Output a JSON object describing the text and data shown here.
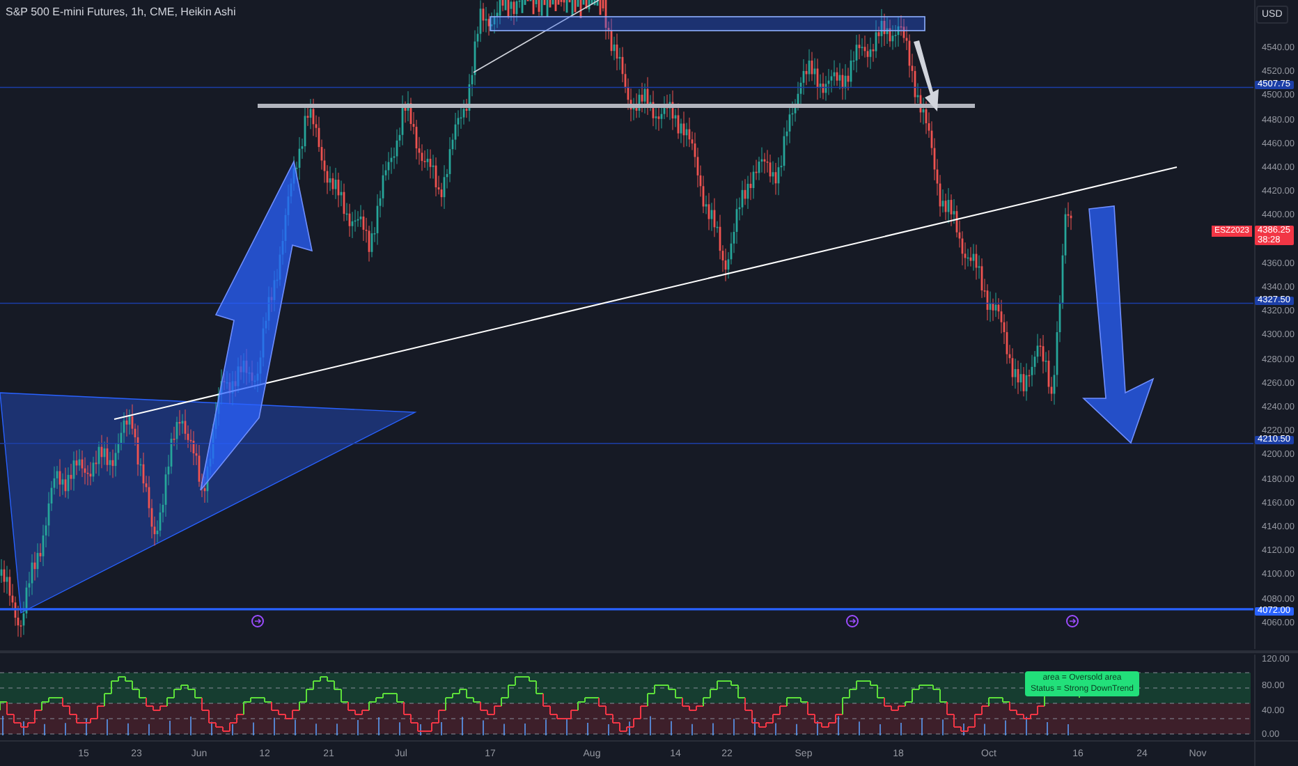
{
  "header": {
    "title": "S&P 500 E-mini Futures, 1h, CME, Heikin Ashi",
    "currency_button": "USD"
  },
  "price_axis": {
    "ticks": [
      "4540.00",
      "4520.00",
      "4500.00",
      "4480.00",
      "4460.00",
      "4440.00",
      "4420.00",
      "4400.00",
      "4360.00",
      "4340.00",
      "4320.00",
      "4300.00",
      "4280.00",
      "4260.00",
      "4240.00",
      "4220.00",
      "4200.00",
      "4180.00",
      "4160.00",
      "4140.00",
      "4120.00",
      "4100.00",
      "4080.00",
      "4060.00"
    ]
  },
  "price_labels": [
    {
      "kind": "level",
      "text": "4507.75",
      "color": "#1c3fa8"
    },
    {
      "kind": "last",
      "text": "4386.25",
      "countdown": "38:28",
      "color": "#f23645"
    },
    {
      "kind": "level",
      "text": "4327.50",
      "color": "#1c3fa8"
    },
    {
      "kind": "level",
      "text": "4210.50",
      "color": "#1c3fa8"
    },
    {
      "kind": "level",
      "text": "4072.00",
      "color": "#2962ff"
    }
  ],
  "symbol_tag": "ESZ2023",
  "indicator": {
    "tooltip_lines": [
      "area = Oversold area",
      "Status =  Strong DownTrend"
    ],
    "axis_ticks": [
      "120.00",
      "80.00",
      "40.00",
      "0.00"
    ]
  },
  "time_axis": [
    "15",
    "23",
    "Jun",
    "12",
    "21",
    "Jul",
    "17",
    "Aug",
    "14",
    "22",
    "Sep",
    "18",
    "Oct",
    "16",
    "24",
    "Nov"
  ]
}
